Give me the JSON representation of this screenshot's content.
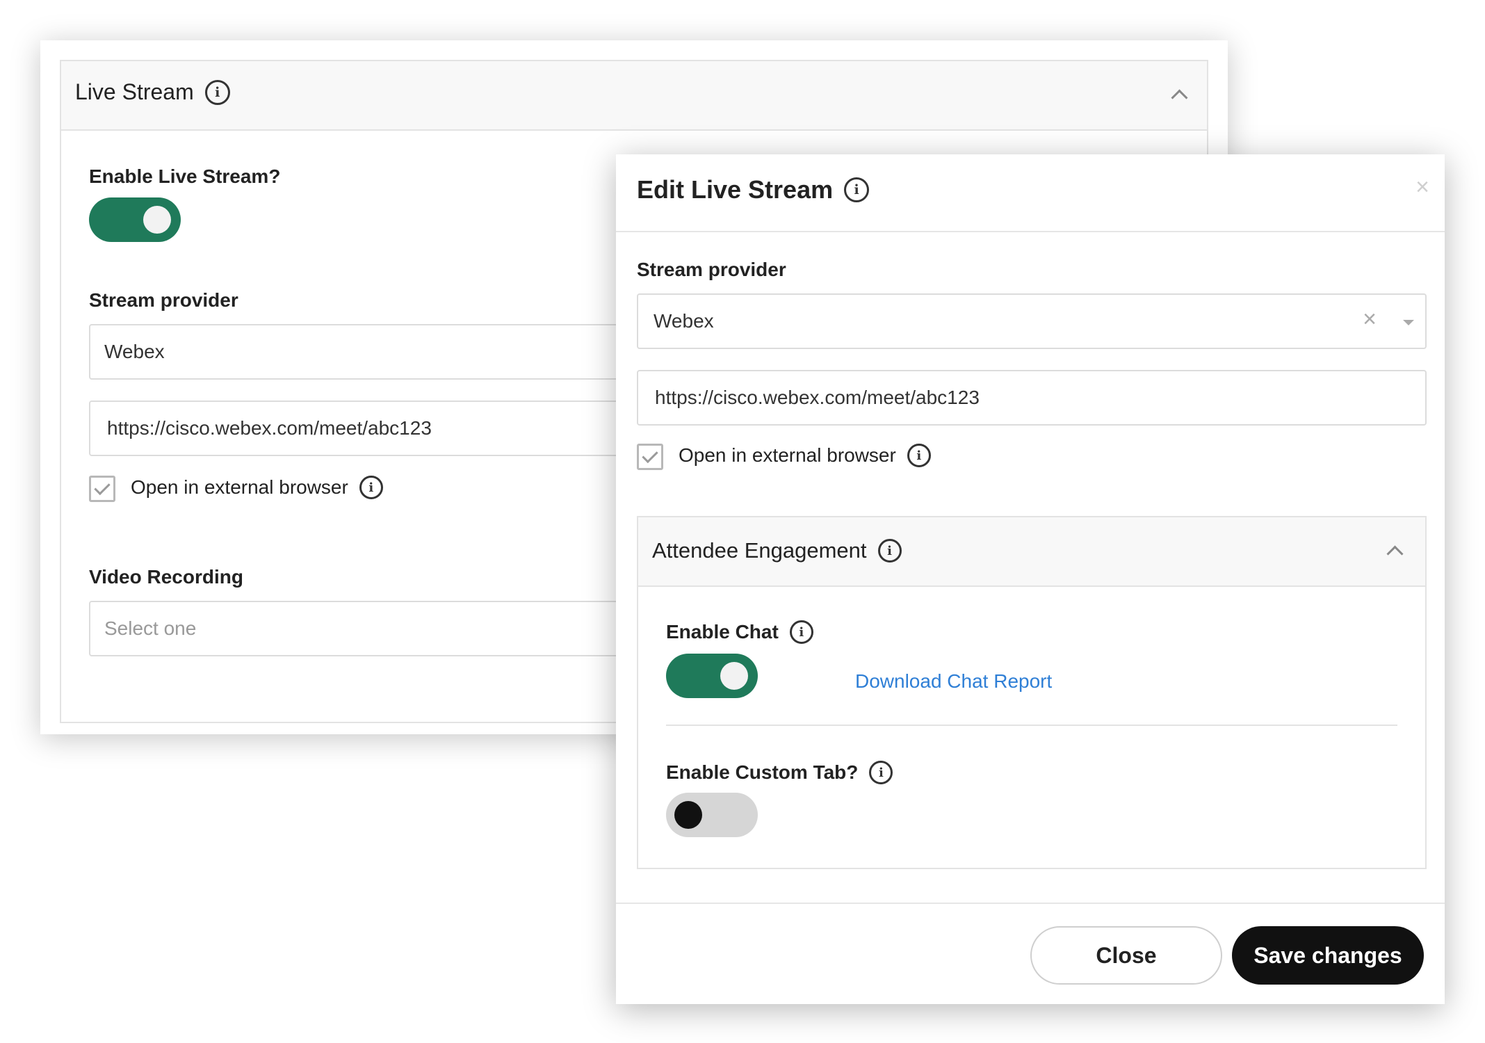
{
  "background_panel": {
    "section_title": "Live Stream",
    "enable_live_stream_label": "Enable Live Stream?",
    "enable_live_stream_on": true,
    "stream_provider_label": "Stream provider",
    "stream_provider_value": "Webex",
    "stream_url": "https://cisco.webex.com/meet/abc123",
    "open_external_label": "Open in external browser",
    "open_external_checked": true,
    "video_recording_label": "Video Recording",
    "video_recording_placeholder": "Select one"
  },
  "modal": {
    "title": "Edit Live Stream",
    "close_x": "×",
    "stream_provider_label": "Stream provider",
    "stream_provider_value": "Webex",
    "clear_x": "×",
    "stream_url": "https://cisco.webex.com/meet/abc123",
    "open_external_label": "Open in external browser",
    "open_external_checked": true,
    "engagement": {
      "title": "Attendee Engagement",
      "enable_chat_label": "Enable Chat",
      "enable_chat_on": true,
      "download_chat_report": "Download Chat Report",
      "enable_custom_tab_label": "Enable Custom Tab?",
      "enable_custom_tab_on": false
    },
    "close_button": "Close",
    "save_button": "Save changes"
  },
  "colors": {
    "toggle_on": "#1f7a5a",
    "link": "#2f7fd6",
    "primary_button": "#111111"
  },
  "icons": {
    "info": "i",
    "collapse": "chevron-up-icon",
    "dropdown": "caret-down-icon"
  }
}
